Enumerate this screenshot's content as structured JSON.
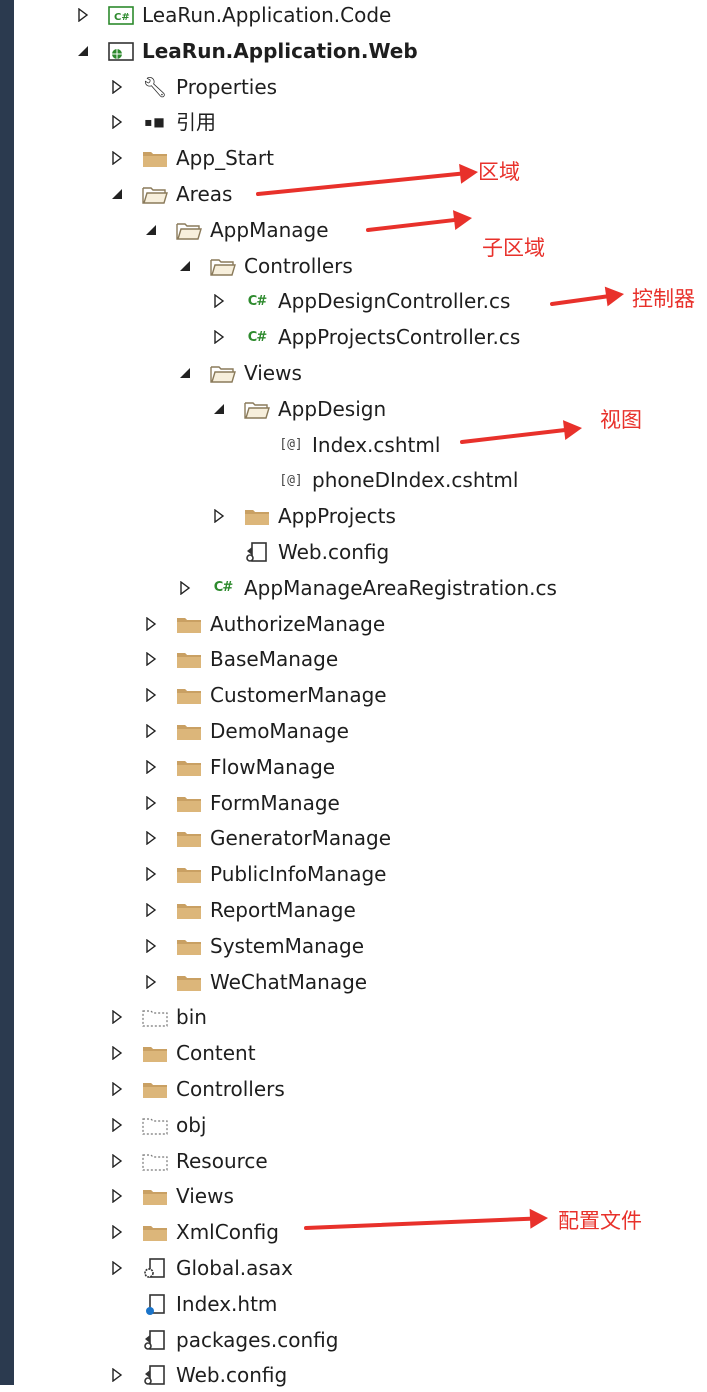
{
  "colors": {
    "accent_arrow": "#e8312b",
    "folder": "#dcb67a",
    "csharp": "#2d8a2d",
    "leftbar": "#2b3a4f"
  },
  "tree": [
    {
      "label": "LeaRun.Application.Code",
      "level": 0,
      "toggle": "collapsed",
      "icon": "csproj",
      "bold": false
    },
    {
      "label": "LeaRun.Application.Web",
      "level": 0,
      "toggle": "expanded",
      "icon": "webproj",
      "bold": true
    },
    {
      "label": "Properties",
      "level": 1,
      "toggle": "collapsed",
      "icon": "wrench",
      "bold": false
    },
    {
      "label": "引用",
      "level": 1,
      "toggle": "collapsed",
      "icon": "references",
      "bold": false
    },
    {
      "label": "App_Start",
      "level": 1,
      "toggle": "collapsed",
      "icon": "folder",
      "bold": false
    },
    {
      "label": "Areas",
      "level": 1,
      "toggle": "expanded",
      "icon": "folder-open",
      "bold": false
    },
    {
      "label": "AppManage",
      "level": 2,
      "toggle": "expanded",
      "icon": "folder-open",
      "bold": false
    },
    {
      "label": "Controllers",
      "level": 3,
      "toggle": "expanded",
      "icon": "folder-open",
      "bold": false
    },
    {
      "label": "AppDesignController.cs",
      "level": 4,
      "toggle": "collapsed",
      "icon": "csharp",
      "bold": false
    },
    {
      "label": "AppProjectsController.cs",
      "level": 4,
      "toggle": "collapsed",
      "icon": "csharp",
      "bold": false
    },
    {
      "label": "Views",
      "level": 3,
      "toggle": "expanded",
      "icon": "folder-open",
      "bold": false
    },
    {
      "label": "AppDesign",
      "level": 4,
      "toggle": "expanded",
      "icon": "folder-open",
      "bold": false
    },
    {
      "label": "Index.cshtml",
      "level": 5,
      "toggle": "none",
      "icon": "razor",
      "bold": false
    },
    {
      "label": "phoneDIndex.cshtml",
      "level": 5,
      "toggle": "none",
      "icon": "razor",
      "bold": false
    },
    {
      "label": "AppProjects",
      "level": 4,
      "toggle": "collapsed",
      "icon": "folder",
      "bold": false
    },
    {
      "label": "Web.config",
      "level": 4,
      "toggle": "none",
      "icon": "config",
      "bold": false
    },
    {
      "label": "AppManageAreaRegistration.cs",
      "level": 3,
      "toggle": "collapsed",
      "icon": "csharp",
      "bold": false
    },
    {
      "label": "AuthorizeManage",
      "level": 2,
      "toggle": "collapsed",
      "icon": "folder",
      "bold": false
    },
    {
      "label": "BaseManage",
      "level": 2,
      "toggle": "collapsed",
      "icon": "folder",
      "bold": false
    },
    {
      "label": "CustomerManage",
      "level": 2,
      "toggle": "collapsed",
      "icon": "folder",
      "bold": false
    },
    {
      "label": "DemoManage",
      "level": 2,
      "toggle": "collapsed",
      "icon": "folder",
      "bold": false
    },
    {
      "label": "FlowManage",
      "level": 2,
      "toggle": "collapsed",
      "icon": "folder",
      "bold": false
    },
    {
      "label": "FormManage",
      "level": 2,
      "toggle": "collapsed",
      "icon": "folder",
      "bold": false
    },
    {
      "label": "GeneratorManage",
      "level": 2,
      "toggle": "collapsed",
      "icon": "folder",
      "bold": false
    },
    {
      "label": "PublicInfoManage",
      "level": 2,
      "toggle": "collapsed",
      "icon": "folder",
      "bold": false
    },
    {
      "label": "ReportManage",
      "level": 2,
      "toggle": "collapsed",
      "icon": "folder",
      "bold": false
    },
    {
      "label": "SystemManage",
      "level": 2,
      "toggle": "collapsed",
      "icon": "folder",
      "bold": false
    },
    {
      "label": "WeChatManage",
      "level": 2,
      "toggle": "collapsed",
      "icon": "folder",
      "bold": false
    },
    {
      "label": "bin",
      "level": 1,
      "toggle": "collapsed",
      "icon": "folder-hidden",
      "bold": false
    },
    {
      "label": "Content",
      "level": 1,
      "toggle": "collapsed",
      "icon": "folder",
      "bold": false
    },
    {
      "label": "Controllers",
      "level": 1,
      "toggle": "collapsed",
      "icon": "folder",
      "bold": false
    },
    {
      "label": "obj",
      "level": 1,
      "toggle": "collapsed",
      "icon": "folder-hidden",
      "bold": false
    },
    {
      "label": "Resource",
      "level": 1,
      "toggle": "collapsed",
      "icon": "folder-hidden",
      "bold": false
    },
    {
      "label": "Views",
      "level": 1,
      "toggle": "collapsed",
      "icon": "folder",
      "bold": false
    },
    {
      "label": "XmlConfig",
      "level": 1,
      "toggle": "collapsed",
      "icon": "folder",
      "bold": false
    },
    {
      "label": "Global.asax",
      "level": 1,
      "toggle": "collapsed",
      "icon": "asax",
      "bold": false
    },
    {
      "label": "Index.htm",
      "level": 1,
      "toggle": "none",
      "icon": "html",
      "bold": false
    },
    {
      "label": "packages.config",
      "level": 1,
      "toggle": "none",
      "icon": "config",
      "bold": false
    },
    {
      "label": "Web.config",
      "level": 1,
      "toggle": "collapsed",
      "icon": "config",
      "bold": false
    }
  ],
  "annotations": [
    {
      "text": "区域",
      "target_row": 5
    },
    {
      "text": "子区域",
      "target_row": 6
    },
    {
      "text": "控制器",
      "target_row": 8
    },
    {
      "text": "视图",
      "target_row": 12
    },
    {
      "text": "配置文件",
      "target_row": 34
    }
  ]
}
